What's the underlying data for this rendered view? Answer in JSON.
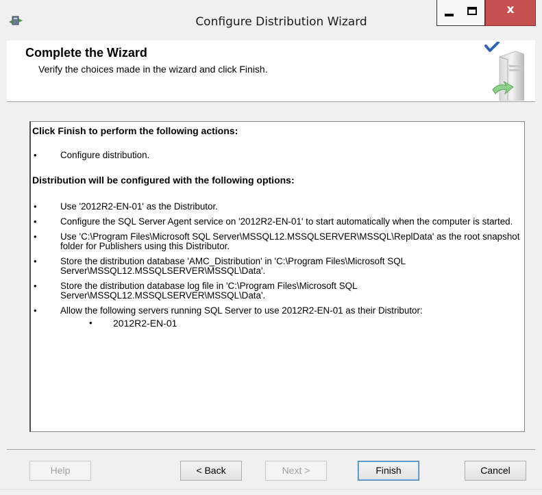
{
  "window": {
    "title": "Configure Distribution Wizard",
    "close_glyph": "x"
  },
  "header": {
    "title": "Complete the Wizard",
    "subtitle": "Verify the choices made in the wizard and click Finish."
  },
  "summary": {
    "actions_heading": "Click Finish to perform the following actions:",
    "actions": [
      "Configure distribution."
    ],
    "options_heading": "Distribution will be configured with the following options:",
    "options": [
      "Use '2012R2-EN-01' as the Distributor.",
      "Configure the SQL Server Agent service on '2012R2-EN-01' to start automatically when the computer is started.",
      "Use 'C:\\Program Files\\Microsoft SQL Server\\MSSQL12.MSSQLSERVER\\MSSQL\\ReplData' as the root snapshot folder for Publishers using this Distributor.",
      "Store the distribution database 'AMC_Distribution' in 'C:\\Program Files\\Microsoft SQL Server\\MSSQL12.MSSQLSERVER\\MSSQL\\Data'.",
      "Store the distribution database log file in 'C:\\Program Files\\Microsoft SQL Server\\MSSQL12.MSSQLSERVER\\MSSQL\\Data'.",
      "Allow the following servers running SQL Server to use 2012R2-EN-01 as their Distributor:"
    ],
    "servers": [
      "2012R2-EN-01"
    ]
  },
  "buttons": {
    "help": "Help",
    "back": "< Back",
    "next": "Next >",
    "finish": "Finish",
    "cancel": "Cancel"
  },
  "colors": {
    "close_button": "#c75050",
    "window_bg": "#f0f0f0",
    "default_button_border": "#3c7fb1"
  }
}
